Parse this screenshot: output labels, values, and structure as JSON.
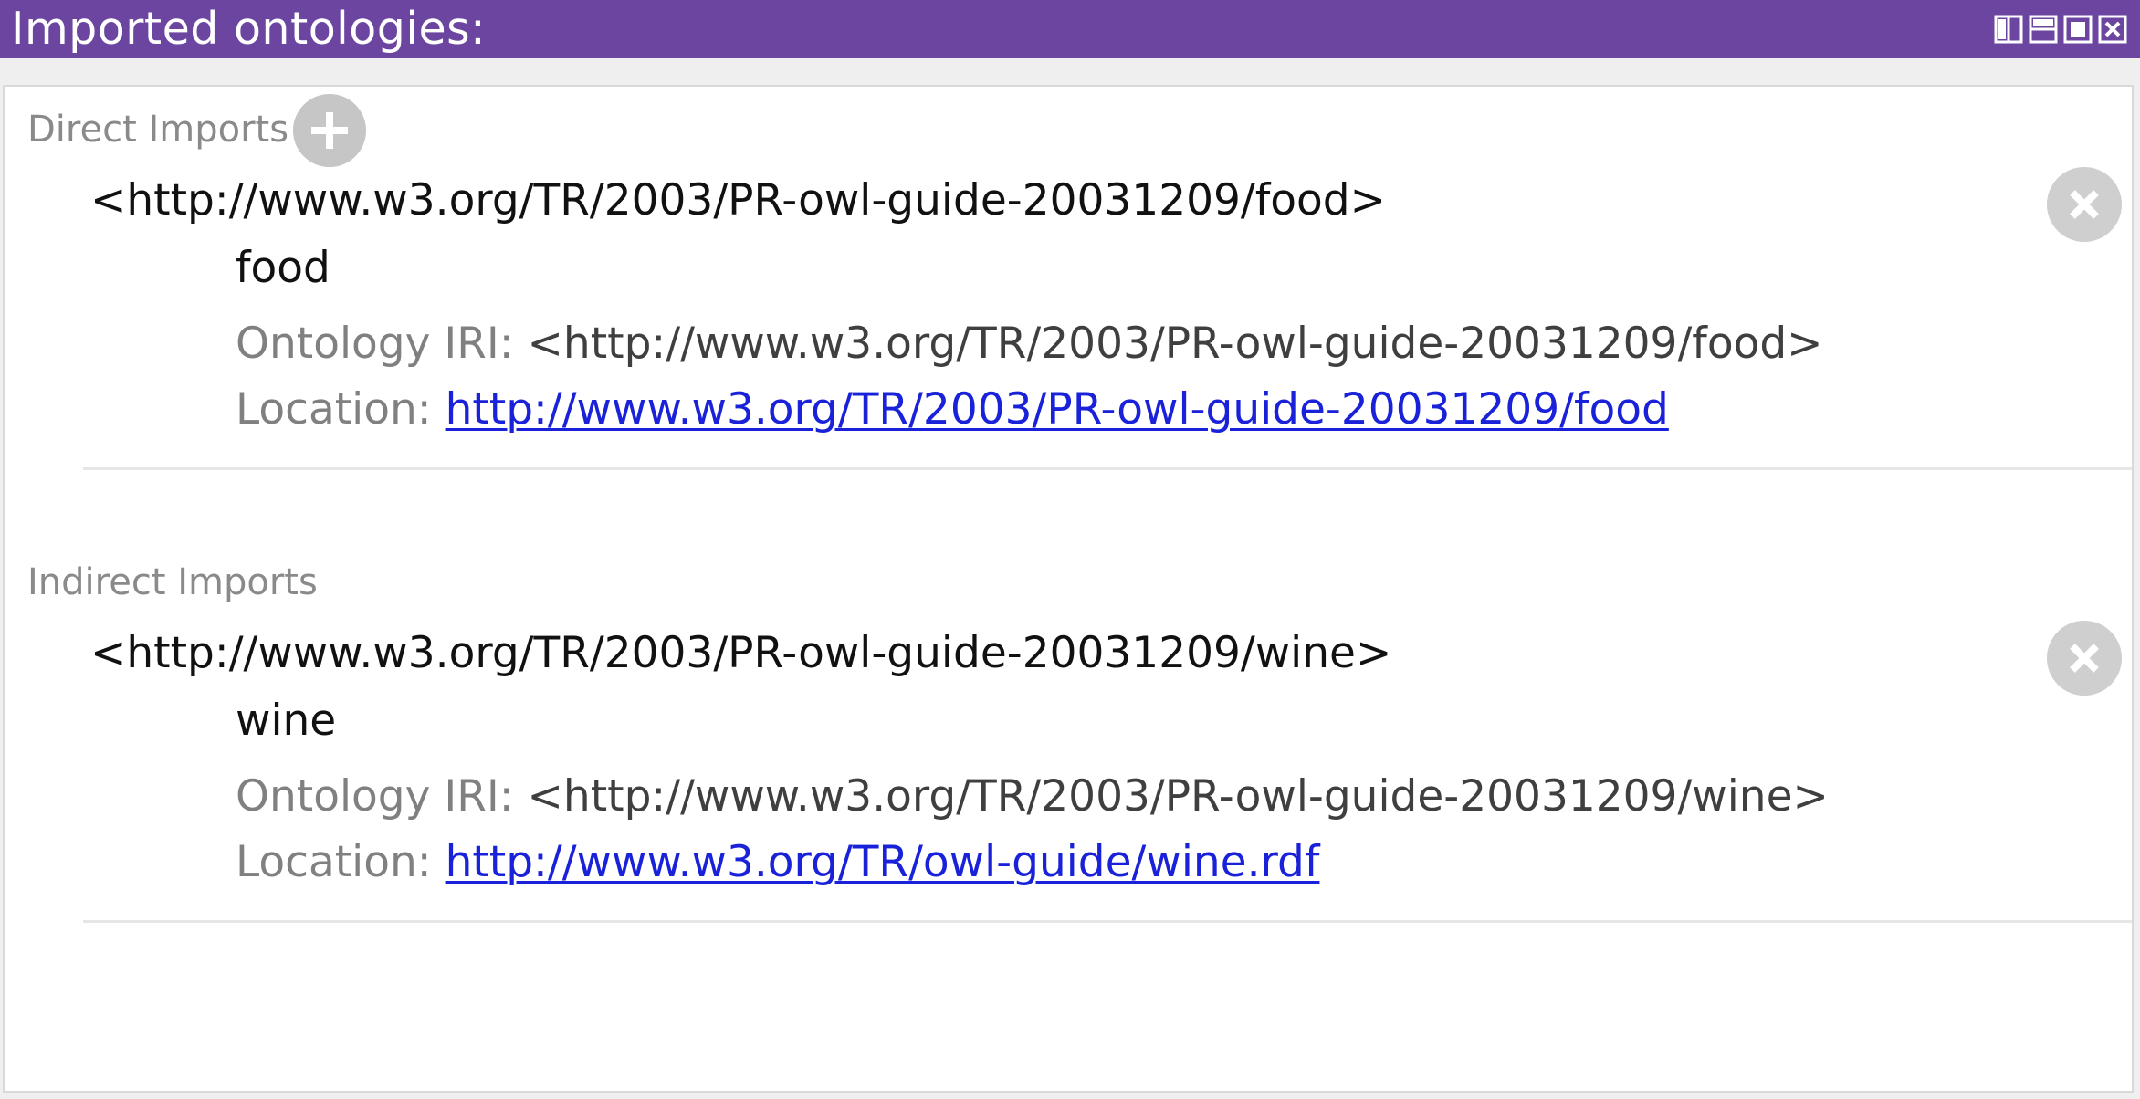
{
  "window": {
    "title": "Imported ontologies:"
  },
  "direct_imports": {
    "label": "Direct Imports",
    "items": [
      {
        "iri": "<http://www.w3.org/TR/2003/PR-owl-guide-20031209/food>",
        "name": "food",
        "ontology_iri_label": "Ontology IRI:",
        "ontology_iri": "<http://www.w3.org/TR/2003/PR-owl-guide-20031209/food>",
        "location_label": "Location:",
        "location": "http://www.w3.org/TR/2003/PR-owl-guide-20031209/food"
      }
    ]
  },
  "indirect_imports": {
    "label": "Indirect Imports",
    "items": [
      {
        "iri": "<http://www.w3.org/TR/2003/PR-owl-guide-20031209/wine>",
        "name": "wine",
        "ontology_iri_label": "Ontology IRI:",
        "ontology_iri": "<http://www.w3.org/TR/2003/PR-owl-guide-20031209/wine>",
        "location_label": "Location:",
        "location": "http://www.w3.org/TR/owl-guide/wine.rdf"
      }
    ]
  },
  "colors": {
    "titlebar": "#6b45a0",
    "link": "#1a22d9",
    "button_gray": "#c6c6c6"
  },
  "icons": [
    "split-horizontal-icon",
    "split-vertical-icon",
    "maximize-icon",
    "close-view-icon",
    "add-icon",
    "remove-icon"
  ]
}
